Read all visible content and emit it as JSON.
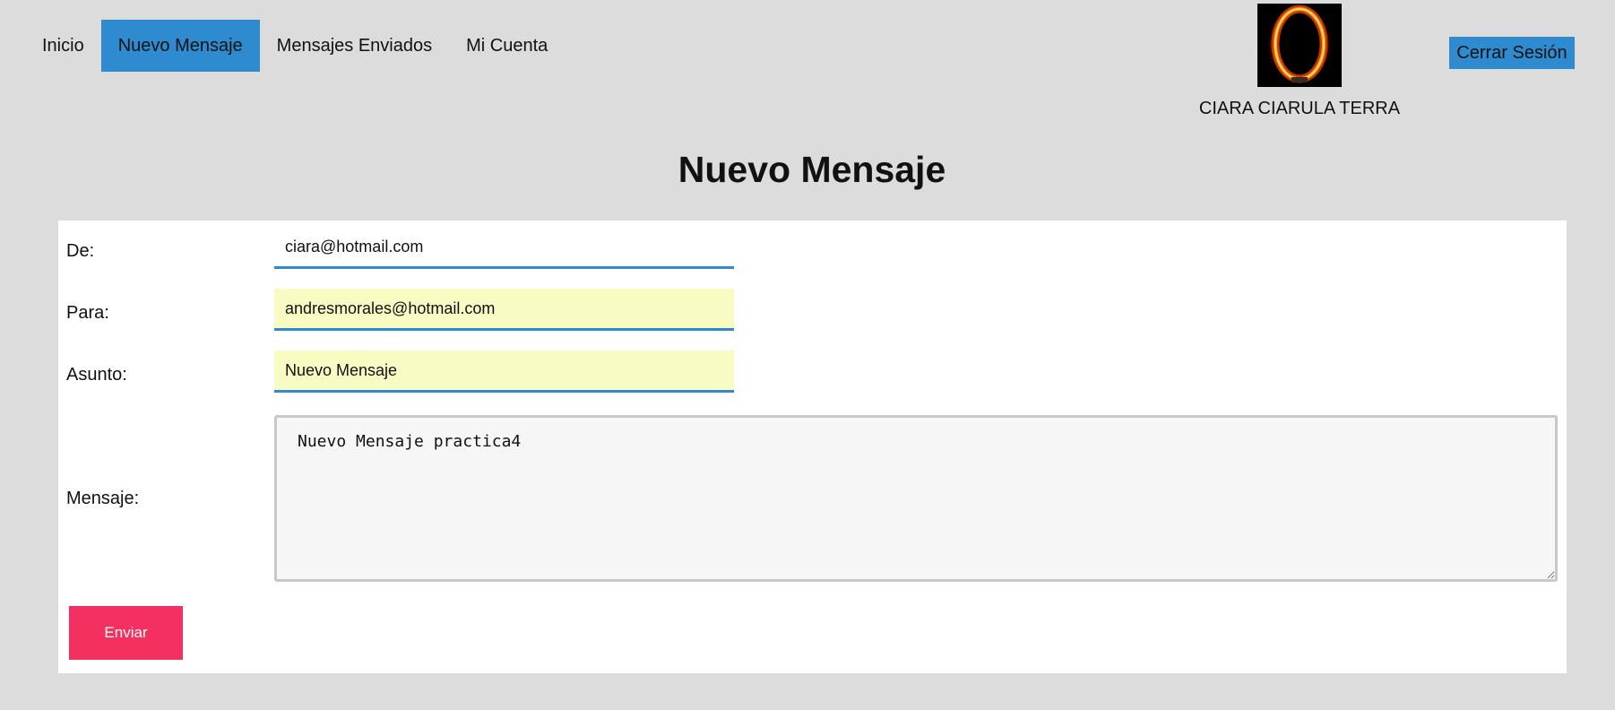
{
  "nav": {
    "items": [
      {
        "label": "Inicio",
        "active": false
      },
      {
        "label": "Nuevo Mensaje",
        "active": true
      },
      {
        "label": "Mensajes Enviados",
        "active": false
      },
      {
        "label": "Mi Cuenta",
        "active": false
      }
    ]
  },
  "profile": {
    "avatar_icon": "ring-of-fire-avatar",
    "name": "CIARA CIARULA TERRA"
  },
  "header": {
    "logout_label": "Cerrar Sesión"
  },
  "page": {
    "title": "Nuevo Mensaje"
  },
  "form": {
    "from_label": "De:",
    "from_value": "ciara@hotmail.com",
    "to_label": "Para:",
    "to_value": "andresmorales@hotmail.com",
    "subject_label": "Asunto:",
    "subject_value": "Nuevo Mensaje",
    "message_label": "Mensaje:",
    "message_value": "Nuevo Mensaje practica4",
    "submit_label": "Enviar"
  },
  "colors": {
    "accent_blue": "#2e8bcf",
    "submit_pink": "#f3305f",
    "autofill_yellow": "#f8fbc2",
    "page_background": "#dcdcdc"
  }
}
